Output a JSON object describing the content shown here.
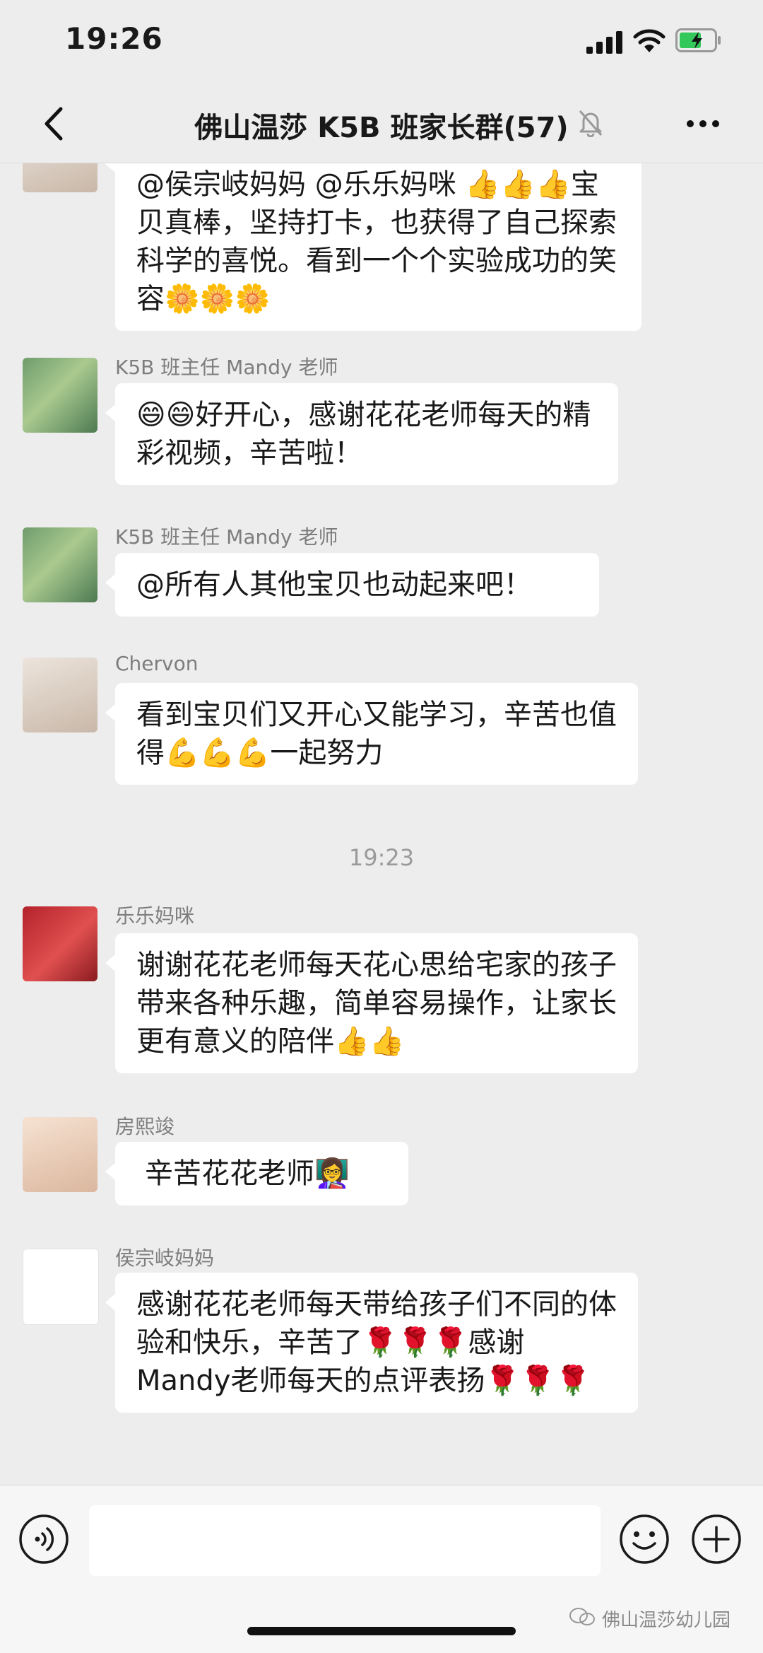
{
  "status_bar": {
    "time": "19:26"
  },
  "nav": {
    "title": "佛山温莎 K5B 班家长群(57)"
  },
  "messages": [
    {
      "text": "@侯宗岐妈妈 @乐乐妈咪 👍👍👍宝贝真棒，坚持打卡，也获得了自己探索科学的喜悦。看到一个个实验成功的笑容🌼🌼🌼"
    },
    {
      "sender": "K5B 班主任 Mandy 老师",
      "text": "😄😄好开心，感谢花花老师每天的精彩视频，辛苦啦！"
    },
    {
      "sender": "K5B 班主任 Mandy 老师",
      "text": "@所有人其他宝贝也动起来吧！"
    },
    {
      "sender": "Chervon",
      "text": "看到宝贝们又开心又能学习，辛苦也值得💪💪💪一起努力"
    },
    {
      "time": "19:23"
    },
    {
      "sender": "乐乐妈咪",
      "text": "谢谢花花老师每天花心思给宅家的孩子带来各种乐趣，简单容易操作，让家长更有意义的陪伴👍👍"
    },
    {
      "sender": "房熙竣",
      "text": "辛苦花花老师👩‍🏫"
    },
    {
      "sender": "侯宗岐妈妈",
      "text": "感谢花花老师每天带给孩子们不同的体验和快乐，辛苦了🌹🌹🌹感谢Mandy老师每天的点评表扬🌹🌹🌹"
    }
  ],
  "input_bar": {
    "watermark": "佛山温莎幼儿园"
  }
}
